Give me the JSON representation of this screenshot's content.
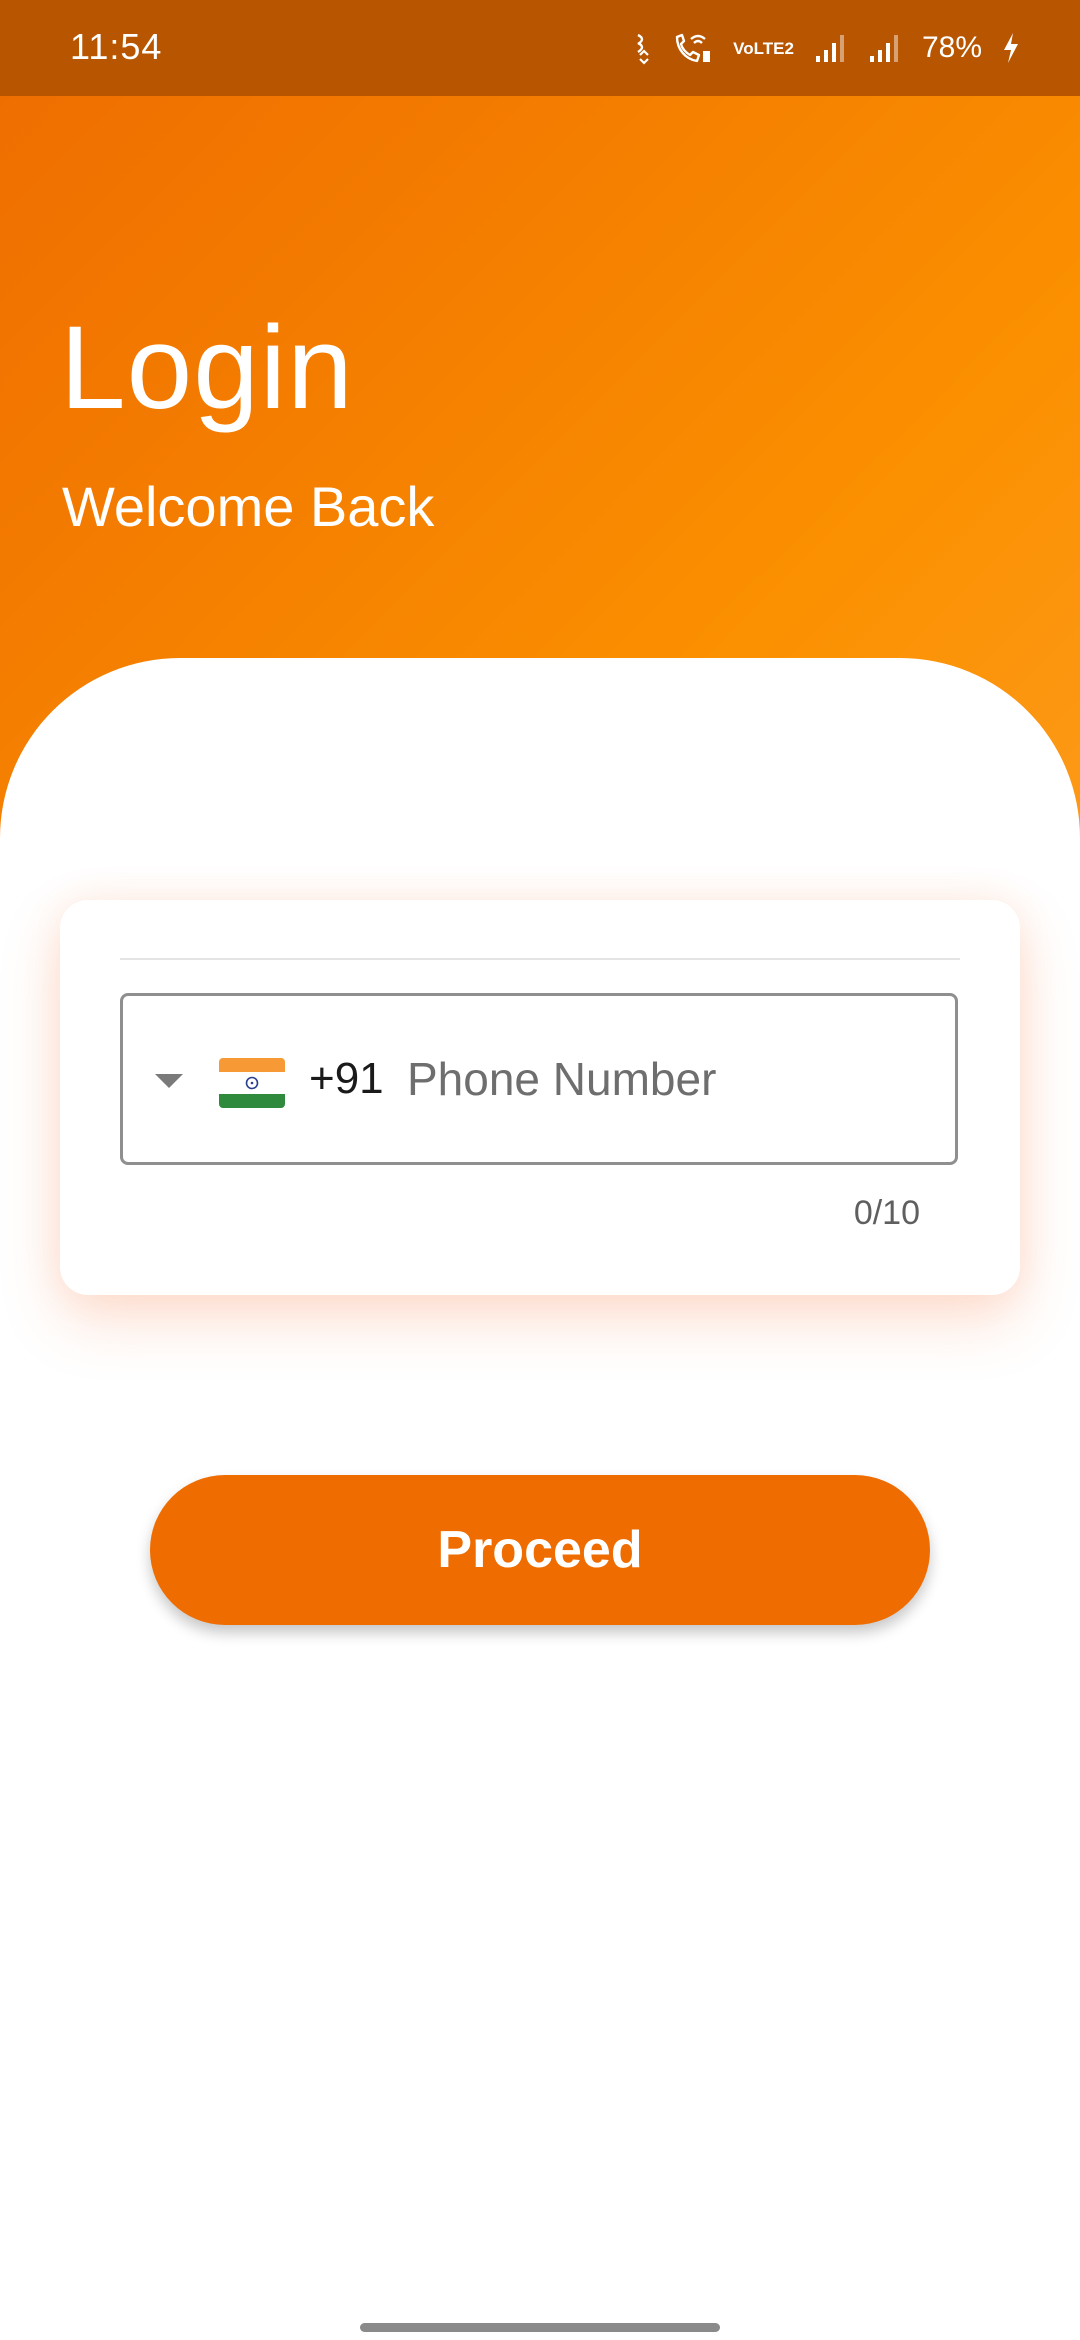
{
  "status_bar": {
    "time": "11:54",
    "volte_top": "Vo",
    "volte_bottom": "LTE2",
    "battery": "78%"
  },
  "header": {
    "title": "Login",
    "subtitle": "Welcome Back"
  },
  "phone_form": {
    "country_flag": "india-flag-icon",
    "dial_code": "+91",
    "placeholder": "Phone Number",
    "value": "",
    "counter": "0/10"
  },
  "actions": {
    "proceed_label": "Proceed"
  },
  "colors": {
    "primary": "#ee6c00",
    "status_bar": "#b75500",
    "gradient_end": "#fd9a1a"
  }
}
